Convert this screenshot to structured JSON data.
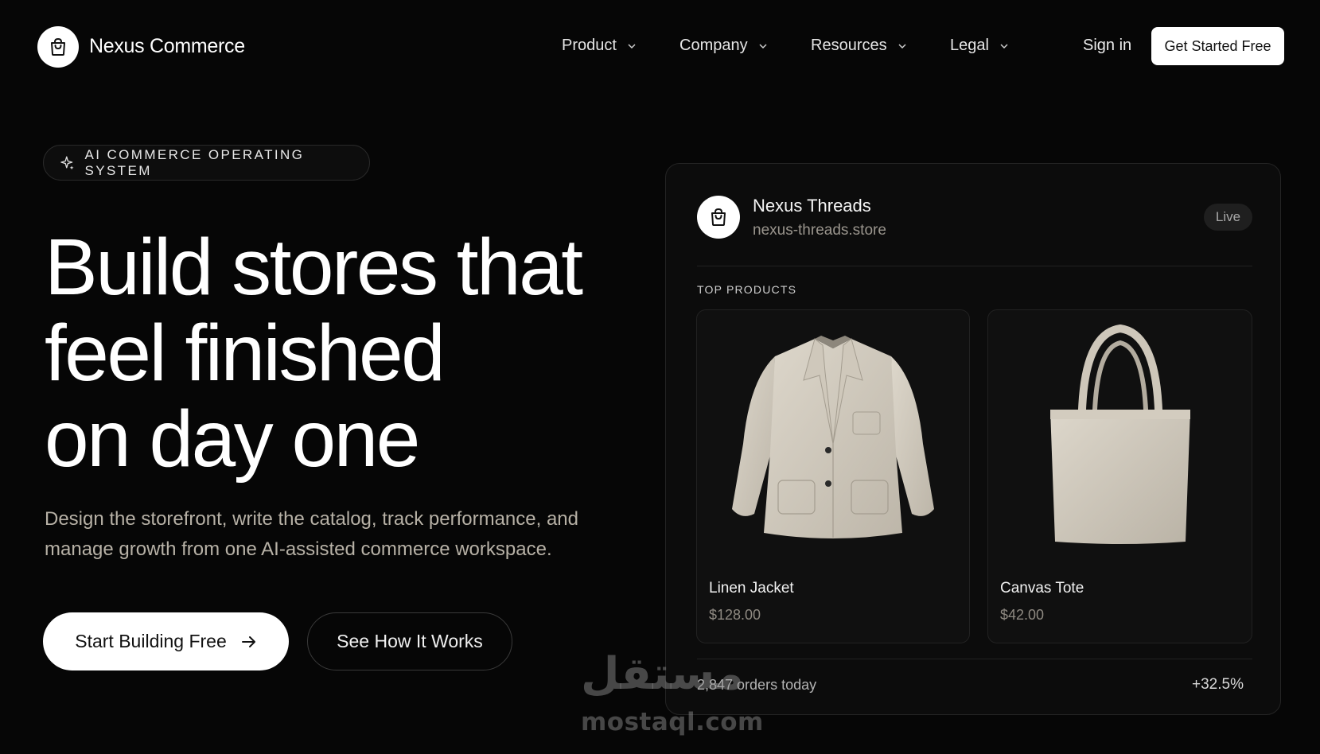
{
  "nav": {
    "brand": "Nexus Commerce",
    "logo_icon": "shopping-bag-icon",
    "menu": [
      {
        "label": "Product"
      },
      {
        "label": "Company"
      },
      {
        "label": "Resources"
      },
      {
        "label": "Legal"
      }
    ],
    "sign_in": "Sign in",
    "cta": "Get Started Free"
  },
  "hero": {
    "badge": "AI COMMERCE OPERATING SYSTEM",
    "badge_icon": "sparkle-icon",
    "headline": [
      "Build stores that",
      "feel finished",
      "on day one"
    ],
    "subheadline": "Design the storefront, write the catalog, track performance, and manage growth from one AI-assisted commerce workspace.",
    "primary_button": "Start Building Free",
    "secondary_button": "See How It Works"
  },
  "card": {
    "store_name": "Nexus Threads",
    "store_url": "nexus-threads.store",
    "status": "Live",
    "section_label": "TOP PRODUCTS",
    "products": [
      {
        "name": "Linen Jacket",
        "price": "$128.00",
        "image": "linen-jacket"
      },
      {
        "name": "Canvas Tote",
        "price": "$42.00",
        "image": "canvas-tote"
      }
    ],
    "orders_today": "2,847 orders today",
    "growth": "+32.5%"
  },
  "watermark": {
    "arabic": "مستقل",
    "latin": "mostaql.com"
  },
  "colors": {
    "background": "#060606",
    "accent": "#ffffff",
    "muted_text": "#b7b1a6",
    "product_fabric": "#d6d0c4"
  }
}
